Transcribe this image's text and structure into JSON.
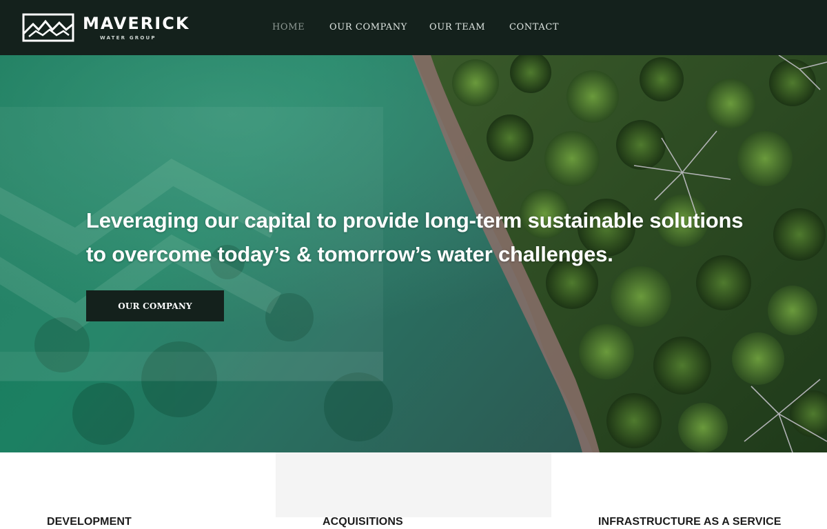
{
  "brand": {
    "name": "MAVERICK",
    "subtitle": "WATER GROUP",
    "logo_icon": "mountain-wave-icon"
  },
  "nav": {
    "items": [
      {
        "label": "HOME",
        "active": true
      },
      {
        "label": "OUR COMPANY",
        "active": false
      },
      {
        "label": "OUR TEAM",
        "active": false
      },
      {
        "label": "CONTACT",
        "active": false
      }
    ]
  },
  "hero": {
    "title": "Leveraging our capital to provide long-term sustainable solutions to overcome today’s & tomorrow’s water challenges.",
    "button_label": "OUR COMPANY",
    "image": "aerial-shoreline-forest"
  },
  "services": {
    "items": [
      {
        "title": "DEVELOPMENT"
      },
      {
        "title": "ACQUISITIONS"
      },
      {
        "title": "INFRASTRUCTURE AS A SERVICE"
      }
    ]
  },
  "colors": {
    "header_bg": "#14211c",
    "water": "#1e6a4f",
    "forest": "#2b4a1e",
    "button_bg": "#14211c",
    "alt_column_bg": "#f4f4f4"
  }
}
